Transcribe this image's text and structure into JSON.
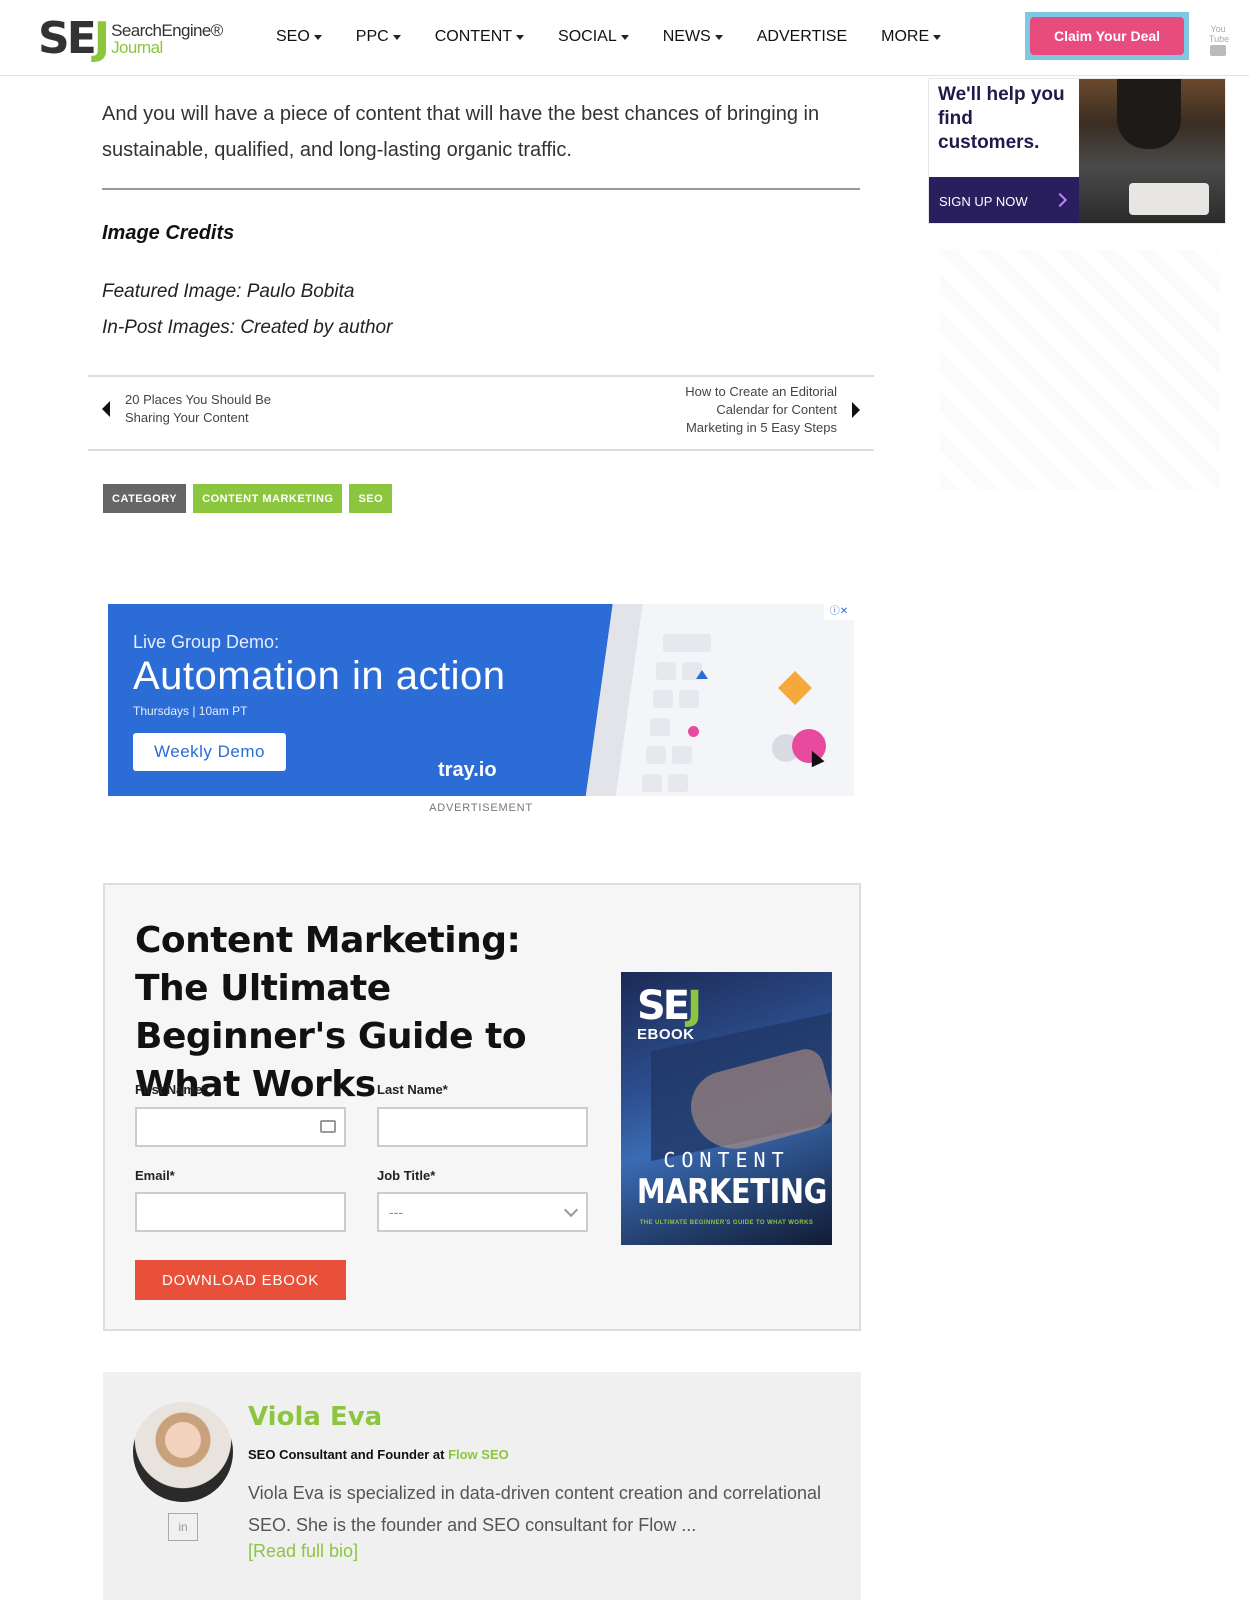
{
  "header": {
    "logo": {
      "mark": "SEJ",
      "line1": "SearchEngine®",
      "line2": "Journal"
    },
    "nav": [
      {
        "label": "SEO",
        "dropdown": true
      },
      {
        "label": "PPC",
        "dropdown": true
      },
      {
        "label": "CONTENT",
        "dropdown": true
      },
      {
        "label": "SOCIAL",
        "dropdown": true
      },
      {
        "label": "NEWS",
        "dropdown": true
      },
      {
        "label": "ADVERTISE",
        "dropdown": false
      },
      {
        "label": "MORE",
        "dropdown": true
      }
    ],
    "cta_label": "Claim Your Deal",
    "youtube_label": "You Tube"
  },
  "article": {
    "closing_paragraph": "And you will have a piece of content that will have the best chances of bringing in sustainable, qualified, and long-lasting organic traffic.",
    "credits_title": "Image Credits",
    "credit_featured": "Featured Image: Paulo Bobita",
    "credit_inpost": "In-Post Images: Created by author"
  },
  "post_nav": {
    "prev_title": "20 Places You Should Be Sharing Your Content",
    "next_title": "How to Create an Editorial Calendar for Content Marketing in 5 Easy Steps"
  },
  "tags": {
    "category_label": "CATEGORY",
    "items": [
      "CONTENT MARKETING",
      "SEO"
    ]
  },
  "ad": {
    "subtitle": "Live Group Demo:",
    "title": "Automation in action",
    "when": "Thursdays | 10am PT",
    "button": "Weekly Demo",
    "brand": "tray.io",
    "label": "ADVERTISEMENT"
  },
  "ebook": {
    "title": "Content Marketing: The Ultimate Beginner's Guide to What Works",
    "first_name_label": "First Name*",
    "last_name_label": "Last Name*",
    "email_label": "Email*",
    "job_title_label": "Job Title*",
    "job_title_value": "---",
    "button": "DOWNLOAD EBOOK",
    "cover": {
      "logo": "SEJ",
      "kicker": "EBOOK",
      "title_top": "CONTENT",
      "title_main": "MARKETING",
      "tagline": "THE ULTIMATE BEGINNER'S GUIDE TO WHAT WORKS"
    }
  },
  "author": {
    "name": "Viola Eva",
    "role_prefix": "SEO Consultant and Founder at ",
    "role_company": "Flow SEO",
    "bio": "Viola Eva is specialized in data-driven content creation and correlational SEO. She is the founder and SEO consultant for Flow ...",
    "read_more": "[Read full bio]",
    "linkedin": "in"
  },
  "sidebar_ad": {
    "text": "We'll help you find customers.",
    "button": "SIGN UP NOW"
  },
  "colors": {
    "brand_green": "#8cc63f",
    "cta_pink": "#e84b7e",
    "ad_blue": "#2b6cd6",
    "download_red": "#e8503a",
    "tag_gray": "#666666"
  }
}
